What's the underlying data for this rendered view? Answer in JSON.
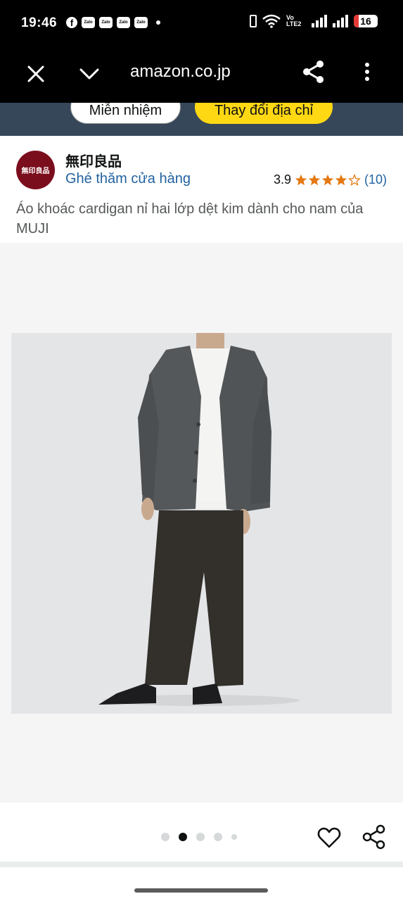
{
  "status_bar": {
    "time": "19:46",
    "notifications": [
      "facebook-icon",
      "zalo-icon",
      "zalo-icon",
      "zalo-icon",
      "zalo-icon",
      "dot-icon"
    ],
    "zalo_label": "Zalo",
    "volte": "Vo LTE2",
    "battery": "16"
  },
  "browser": {
    "url": "amazon.co.jp",
    "icons": [
      "close-icon",
      "chevron-down-icon",
      "share-icon",
      "more-vert-icon"
    ]
  },
  "address_bar": {
    "dismiss_label": "Miễn nhiệm",
    "change_label": "Thay đổi địa chỉ",
    "bg_color": "#37475a",
    "accent": "#ffd814"
  },
  "store": {
    "logo_text": "無印良品",
    "name": "無印良品",
    "visit_link": "Ghé thăm cửa hàng",
    "rating": "3.9",
    "stars": 3.9,
    "review_count": "(10)",
    "star_color": "#e47911",
    "link_color": "#2162a1"
  },
  "product": {
    "title": "Áo khoác cardigan nỉ hai lớp dệt kim dành cho nam của MUJI"
  },
  "carousel": {
    "dot_count": 5,
    "active_index": 1,
    "icons": [
      "heart-icon",
      "share-icon"
    ]
  }
}
